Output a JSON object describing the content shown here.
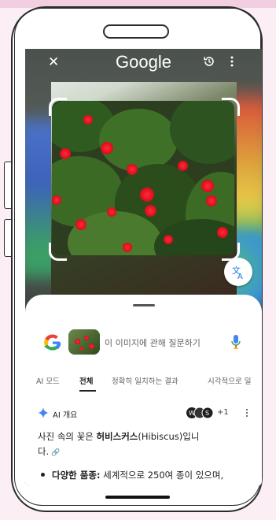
{
  "app": {
    "title": "Google"
  },
  "search": {
    "placeholder": "이 이미지에 관해 질문하기"
  },
  "tabs": [
    {
      "label": "AI 모드",
      "active": false
    },
    {
      "label": "전체",
      "active": true
    },
    {
      "label": "정확히 일치하는 결과",
      "active": false
    },
    {
      "label": "시각적으로 일",
      "active": false
    }
  ],
  "overview": {
    "label": "AI 개요",
    "source_count": "+1"
  },
  "answer": {
    "line1_prefix": "사진 속의 꽃은 ",
    "line1_bold": "허비스커스",
    "line1_suffix": "(Hibiscus)입니",
    "line2": "다."
  },
  "bullet": {
    "bold": "다양한 품종:",
    "text": " 세계적으로 250여 종이 있으며,"
  },
  "colors": {
    "accent_blue": "#4285f4",
    "flower_red": "#e0101e",
    "text_primary": "#202124",
    "text_secondary": "#5f6368"
  },
  "icons": [
    "close-icon",
    "history-icon",
    "more-vert-icon",
    "translate-icon",
    "google-g-icon",
    "mic-icon",
    "sparkle-icon",
    "link-icon"
  ]
}
